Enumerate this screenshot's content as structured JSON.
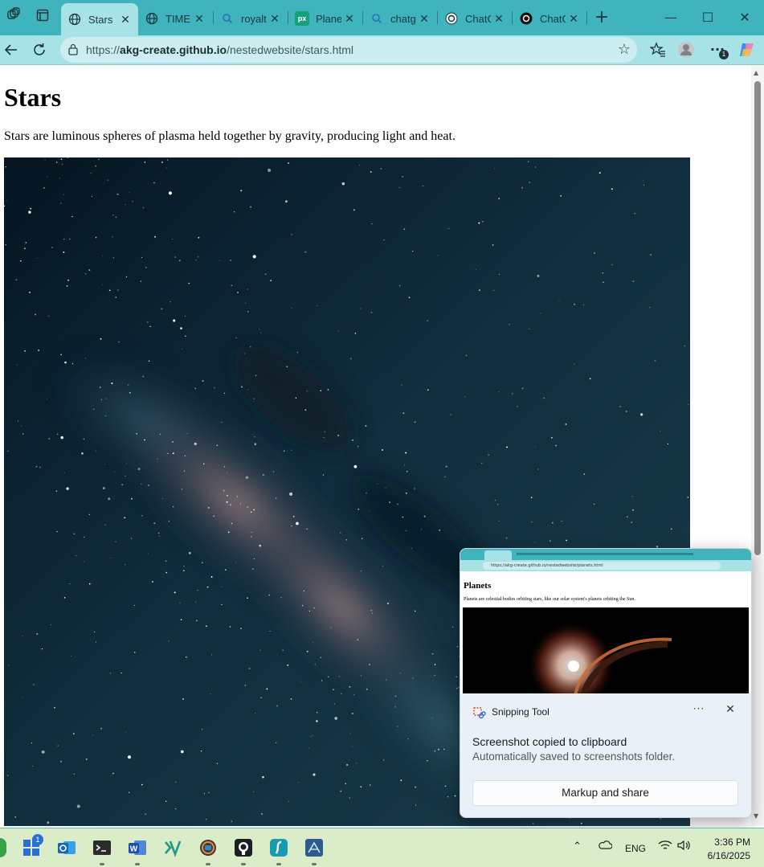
{
  "browser": {
    "tabs": [
      {
        "title": "Stars",
        "icon": "globe-icon",
        "active": true
      },
      {
        "title": "TIME I",
        "icon": "globe-icon",
        "active": false
      },
      {
        "title": "royalty",
        "icon": "search-icon",
        "active": false
      },
      {
        "title": "Planet",
        "icon": "pexels-icon",
        "active": false
      },
      {
        "title": "chatgp",
        "icon": "search-icon",
        "active": false
      },
      {
        "title": "ChatG",
        "icon": "chatgpt-icon",
        "active": false
      },
      {
        "title": "ChatG",
        "icon": "chatgpt-icon",
        "active": false
      }
    ],
    "url_prefix": "https://",
    "url_host": "akg-create.github.io",
    "url_path": "/nestedwebsite/stars.html",
    "notification_badge": "1",
    "accent": "#3fb4bd"
  },
  "page": {
    "title": "Stars",
    "description": "Stars are luminous spheres of plasma held together by gravity, producing light and heat."
  },
  "notification": {
    "app_name": "Snipping Tool",
    "heading": "Screenshot copied to clipboard",
    "subtext": "Automatically saved to screenshots folder.",
    "action_label": "Markup and share",
    "more_label": "···",
    "preview": {
      "url": "https://akg-create.github.io/nestedwebsite/planets.html",
      "title": "Planets",
      "description": "Planets are celestial bodies orbiting stars, like our solar system's planets orbiting the Sun."
    }
  },
  "taskbar": {
    "start_badge": "1",
    "apps": [
      "outlook-icon",
      "terminal-icon",
      "word-icon",
      "vscode-icon",
      "snip-icon",
      "github-icon",
      "surfshark-icon",
      "sql-icon"
    ],
    "tray_language": "ENG",
    "time": "3:36 PM",
    "date": "6/16/2025"
  }
}
